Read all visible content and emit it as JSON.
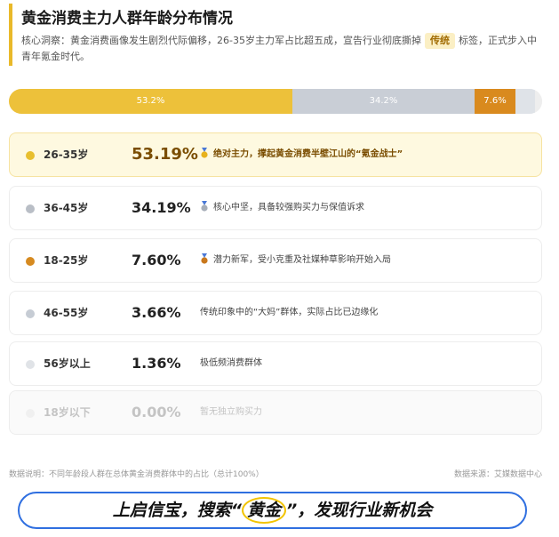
{
  "header": {
    "title": "黄金消费主力人群年龄分布情况",
    "insight_before": "核心洞察：黄金消费画像发生剧烈代际偏移，26-35岁主力军占比超五成，宣告行业彻底撕掉",
    "insight_tag": "传统",
    "insight_after": "标签，正式步入中青年氪金时代。"
  },
  "chart_data": {
    "type": "bar",
    "title": "黄金消费主力人群年龄分布情况",
    "stacked_bar": [
      {
        "label": "53.2%",
        "value": 53.2,
        "color": "#edc13a"
      },
      {
        "label": "34.2%",
        "value": 34.2,
        "color": "#c9ced6"
      },
      {
        "label": "7.6%",
        "value": 7.6,
        "color": "#d98a1e"
      },
      {
        "label": "",
        "value": 3.7,
        "color": "#dfe3e8"
      },
      {
        "label": "",
        "value": 1.3,
        "color": "#eeeeee"
      }
    ],
    "categories": [
      "26-35岁",
      "36-45岁",
      "18-25岁",
      "46-55岁",
      "56岁以上",
      "18岁以下"
    ],
    "values": [
      53.19,
      34.19,
      7.6,
      3.66,
      1.36,
      0.0
    ],
    "value_labels": [
      "53.19%",
      "34.19%",
      "7.60%",
      "3.66%",
      "1.36%",
      "0.00%"
    ],
    "descriptions": [
      "绝对主力，撑起黄金消费半壁江山的“氪金战士”",
      "核心中坚，具备较强购买力与保值诉求",
      "潜力新军，受小克重及社媒种草影响开始入局",
      "传统印象中的“大妈”群体，实际占比已边缘化",
      "极低频消费群体",
      "暂无独立购买力"
    ],
    "dot_colors": [
      "#e8bf2e",
      "#b9bec6",
      "#d68a20",
      "#c6ccd4",
      "#e0e3e7",
      "#f0f0f0"
    ],
    "medals": [
      "gold-medal-icon",
      "silver-medal-icon",
      "bronze-medal-icon",
      "",
      "",
      ""
    ],
    "medal_colors": [
      "#e8b21c",
      "#a7aeb8",
      "#c9781d",
      "",
      "",
      ""
    ],
    "highlight_index": 0,
    "faded_index": 5
  },
  "footer": {
    "note": "数据说明：不同年龄段人群在总体黄金消费群体中的占比（总计100%）",
    "source": "数据来源：艾媒数据中心"
  },
  "banner": {
    "before": "上启信宝，搜索“",
    "keyword": "黄金",
    "after": "”，发现行业新机会",
    "border_color": "#2f6fe0"
  }
}
